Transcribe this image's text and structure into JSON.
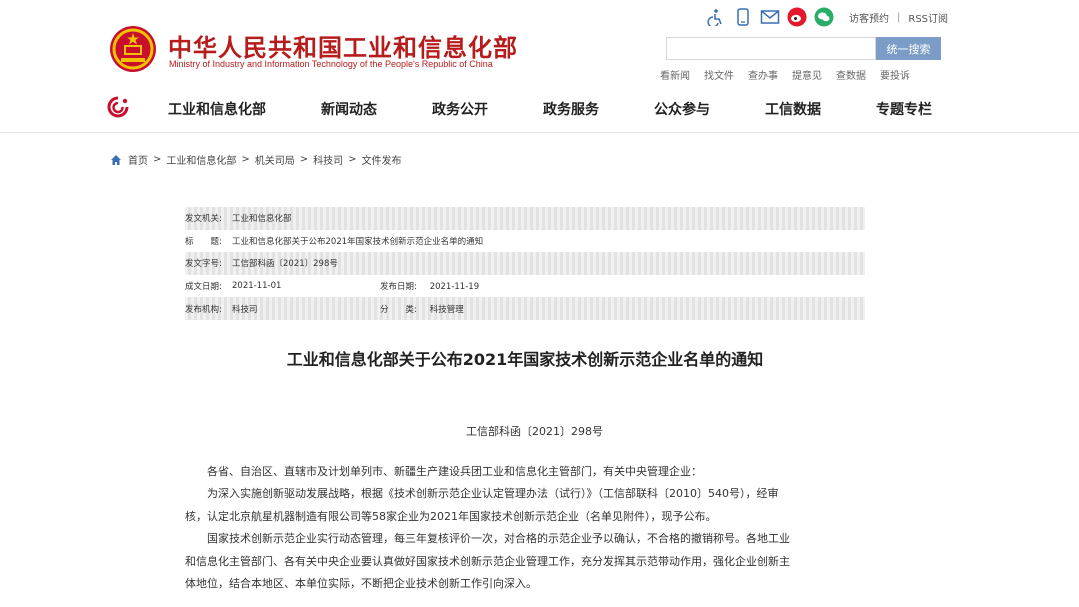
{
  "header": {
    "site_name": "中华人民共和国工业和信息化部",
    "site_name_en": "Ministry of Industry and Information Technology of the People's Republic of China",
    "top_icons": [
      "accessibility-icon",
      "mobile-icon",
      "mail-icon",
      "weibo-icon",
      "wechat-icon"
    ],
    "top_links": [
      "访客预约",
      "RSS订阅"
    ],
    "search": {
      "placeholder": "",
      "button": "统一搜索"
    },
    "quick_links": [
      "看新闻",
      "找文件",
      "查办事",
      "提意见",
      "查数据",
      "要投诉"
    ],
    "nav": [
      "工业和信息化部",
      "新闻动态",
      "政务公开",
      "政务服务",
      "公众参与",
      "工信数据",
      "专题专栏"
    ]
  },
  "breadcrumb": [
    "首页",
    "工业和信息化部",
    "机关司局",
    "科技司",
    "文件发布"
  ],
  "meta": {
    "issuer_label": "发文机关:",
    "issuer": "工业和信息化部",
    "title_label": "标　　题:",
    "title": "工业和信息化部关于公布2021年国家技术创新示范企业名单的通知",
    "doc_no_label": "发文字号:",
    "doc_no": "工信部科函〔2021〕298号",
    "created_label": "成文日期:",
    "created": "2021-11-01",
    "published_label": "发布日期:",
    "published": "2021-11-19",
    "agency_label": "发布机构:",
    "agency": "科技司",
    "category_label": "分　　类:",
    "category": "科技管理"
  },
  "article": {
    "title": "工业和信息化部关于公布2021年国家技术创新示范企业名单的通知",
    "doc_no": "工信部科函〔2021〕298号",
    "lines": [
      "　　各省、自治区、直辖市及计划单列市、新疆生产建设兵团工业和信息化主管部门，有关中央管理企业：",
      "　　为深入实施创新驱动发展战略，根据《技术创新示范企业认定管理办法（试行）》（工信部联科〔2010〕540号），经审",
      "核，认定北京航星机器制造有限公司等58家企业为2021年国家技术创新示范企业（名单见附件），现予公布。",
      "　　国家技术创新示范企业实行动态管理，每三年复核评价一次，对合格的示范企业予以确认，不合格的撤销称号。各地工业",
      "和信息化主管部门、各有关中央企业要认真做好国家技术创新示范企业管理工作，充分发挥其示范带动作用，强化企业创新主",
      "体地位，结合本地区、本单位实际，不断把企业技术创新工作引向深入。"
    ]
  },
  "colors": {
    "brand_red": "#b71c1c",
    "search_button": "#7b9cc6"
  }
}
